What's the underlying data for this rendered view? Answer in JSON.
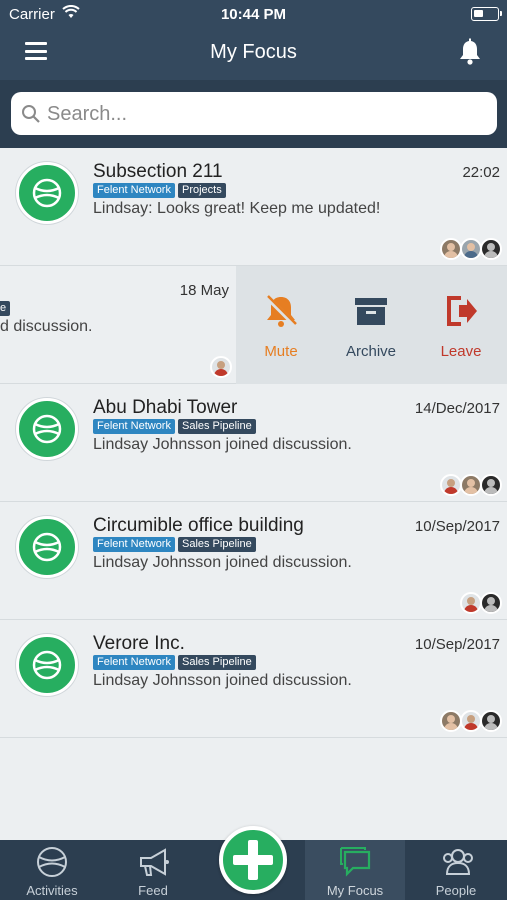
{
  "status_bar": {
    "carrier": "Carrier",
    "time": "10:44 PM"
  },
  "header": {
    "title": "My Focus"
  },
  "search": {
    "placeholder": "Search..."
  },
  "colors": {
    "accent_green": "#27ae60",
    "nav_dark": "#34495e",
    "tag_blue": "#2e86c1",
    "mute_orange": "#e67e22",
    "leave_red": "#c0392b"
  },
  "discussions": [
    {
      "name": "Subsection 211",
      "date": "22:02",
      "tags": [
        "Felent Network",
        "Projects"
      ],
      "message": "Lindsay: Looks great! Keep me updated!"
    },
    {
      "name": "",
      "date": "18 May",
      "tags": [
        "e"
      ],
      "message": "d discussion."
    },
    {
      "name": "Abu Dhabi Tower",
      "date": "14/Dec/2017",
      "tags": [
        "Felent Network",
        "Sales Pipeline"
      ],
      "message": "Lindsay Johnsson joined discussion."
    },
    {
      "name": "Circumible office building",
      "date": "10/Sep/2017",
      "tags": [
        "Felent Network",
        "Sales Pipeline"
      ],
      "message": "Lindsay Johnsson joined discussion."
    },
    {
      "name": "Verore Inc.",
      "date": "10/Sep/2017",
      "tags": [
        "Felent Network",
        "Sales Pipeline"
      ],
      "message": "Lindsay Johnsson joined discussion."
    }
  ],
  "swipe_actions": {
    "mute": "Mute",
    "archive": "Archive",
    "leave": "Leave"
  },
  "tabbar": {
    "activities": "Activities",
    "feed": "Feed",
    "my_focus": "My Focus",
    "people": "People"
  }
}
